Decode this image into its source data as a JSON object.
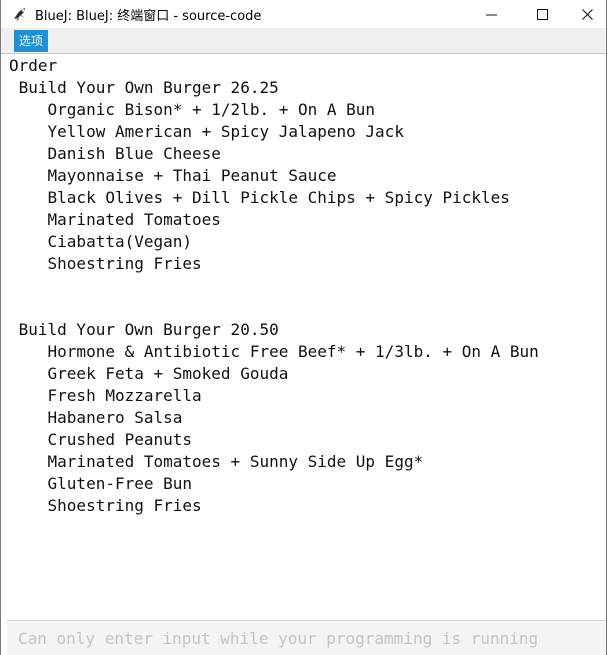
{
  "window": {
    "title": "BlueJ: BlueJ:  终端窗口 - source-code",
    "app_icon": "bluej-bird-icon",
    "controls": [
      "minimize-icon",
      "maximize-icon",
      "close-icon"
    ]
  },
  "menu": {
    "options_label": "选项"
  },
  "output": {
    "lines": [
      "Order",
      " Build Your Own Burger 26.25",
      "    Organic Bison* + 1/2lb. + On A Bun",
      "    Yellow American + Spicy Jalapeno Jack",
      "    Danish Blue Cheese",
      "    Mayonnaise + Thai Peanut Sauce",
      "    Black Olives + Dill Pickle Chips + Spicy Pickles",
      "    Marinated Tomatoes",
      "    Ciabatta(Vegan)",
      "    Shoestring Fries",
      "",
      "",
      " Build Your Own Burger 20.50",
      "    Hormone & Antibiotic Free Beef* + 1/3lb. + On A Bun",
      "    Greek Feta + Smoked Gouda",
      "    Fresh Mozzarella",
      "    Habanero Salsa",
      "    Crushed Peanuts",
      "    Marinated Tomatoes + Sunny Side Up Egg*",
      "    Gluten-Free Bun",
      "    Shoestring Fries"
    ]
  },
  "input": {
    "value": "",
    "placeholder": "Can only enter input while your programming is running"
  }
}
